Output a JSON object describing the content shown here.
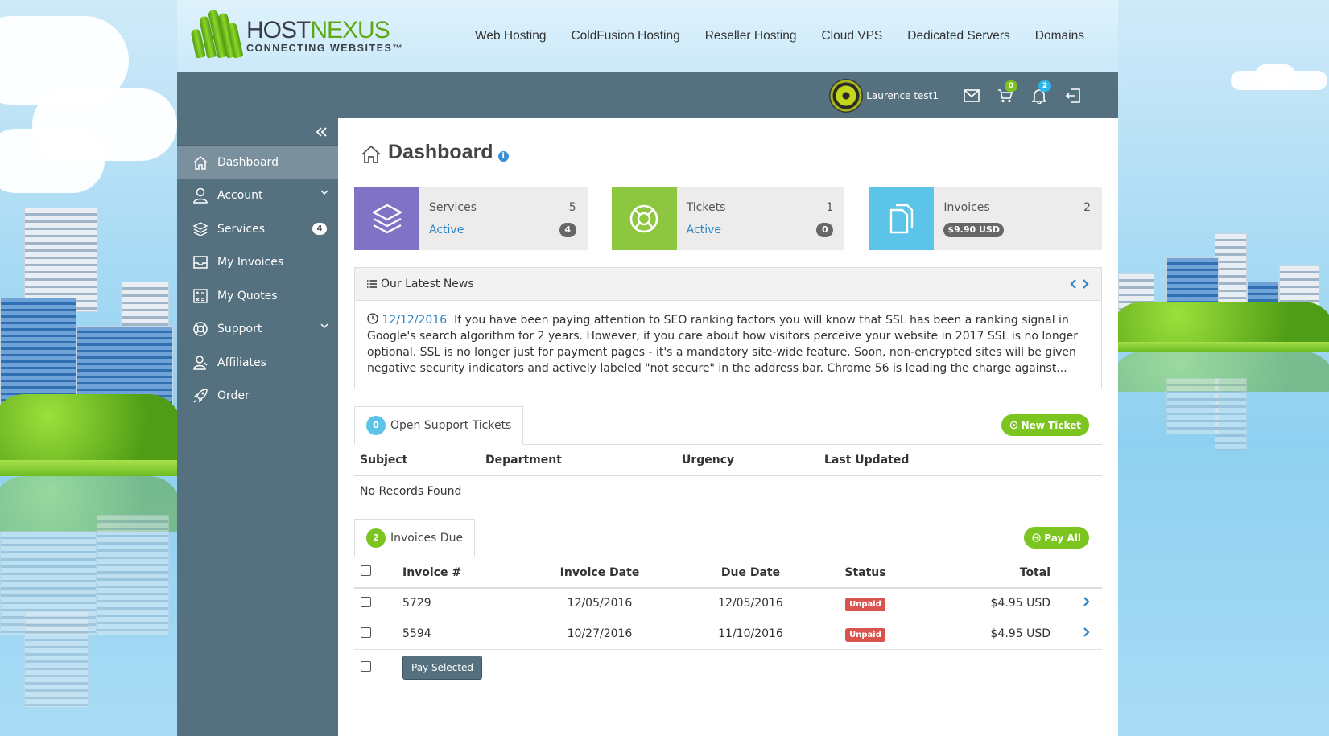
{
  "logo": {
    "host": "HOST",
    "nexus": "NEXUS",
    "tagline": "CONNECTING WEBSITES™"
  },
  "top_nav": [
    "Web Hosting",
    "ColdFusion Hosting",
    "Reseller Hosting",
    "Cloud VPS",
    "Dedicated Servers",
    "Domains"
  ],
  "userbar": {
    "username": "Laurence test1",
    "cart_count": "0",
    "notification_count": "2"
  },
  "sidebar": {
    "items": [
      {
        "label": "Dashboard",
        "icon": "home-icon",
        "active": true
      },
      {
        "label": "Account",
        "icon": "user-icon",
        "has_chevron": true
      },
      {
        "label": "Services",
        "icon": "layers-icon",
        "badge": "4"
      },
      {
        "label": "My Invoices",
        "icon": "inbox-icon"
      },
      {
        "label": "My Quotes",
        "icon": "quote-icon"
      },
      {
        "label": "Support",
        "icon": "lifebuoy-icon",
        "has_chevron": true
      },
      {
        "label": "Affiliates",
        "icon": "affiliates-icon"
      },
      {
        "label": "Order",
        "icon": "rocket-icon"
      }
    ]
  },
  "page": {
    "title": "Dashboard"
  },
  "tiles": [
    {
      "title": "Services",
      "count": "5",
      "sub": "Active",
      "sub_badge": "4",
      "color": "#8073c6"
    },
    {
      "title": "Tickets",
      "count": "1",
      "sub": "Active",
      "sub_badge": "0",
      "color": "#8dc63f"
    },
    {
      "title": "Invoices",
      "count": "2",
      "sub_badge": "$9.90 USD",
      "color": "#5bc4e8"
    }
  ],
  "news": {
    "heading": "Our Latest News",
    "date": "12/12/2016",
    "text": "If you have been paying attention to SEO ranking factors you will know that SSL has been a ranking signal in Google's search algorithm for 2 years. However, if you care about how visitors perceive your website in 2017 SSL is no longer optional. SSL is no longer just for payment pages - it's a mandatory site-wide feature. Soon, non-encrypted sites will be given negative security indicators and actively labeled \"not secure\" in the address bar. Chrome 56 is leading the charge against..."
  },
  "tickets": {
    "count": "0",
    "tab_label": "Open Support Tickets",
    "new_button": "New Ticket",
    "columns": [
      "Subject",
      "Department",
      "Urgency",
      "Last Updated"
    ],
    "empty_text": "No Records Found"
  },
  "invoices": {
    "count": "2",
    "tab_label": "Invoices Due",
    "pay_all_button": "Pay All",
    "columns": [
      "Invoice #",
      "Invoice Date",
      "Due Date",
      "Status",
      "Total"
    ],
    "rows": [
      {
        "number": "5729",
        "invoice_date": "12/05/2016",
        "due_date": "12/05/2016",
        "status": "Unpaid",
        "total": "$4.95 USD"
      },
      {
        "number": "5594",
        "invoice_date": "10/27/2016",
        "due_date": "11/10/2016",
        "status": "Unpaid",
        "total": "$4.95 USD"
      }
    ],
    "pay_selected_button": "Pay Selected"
  }
}
